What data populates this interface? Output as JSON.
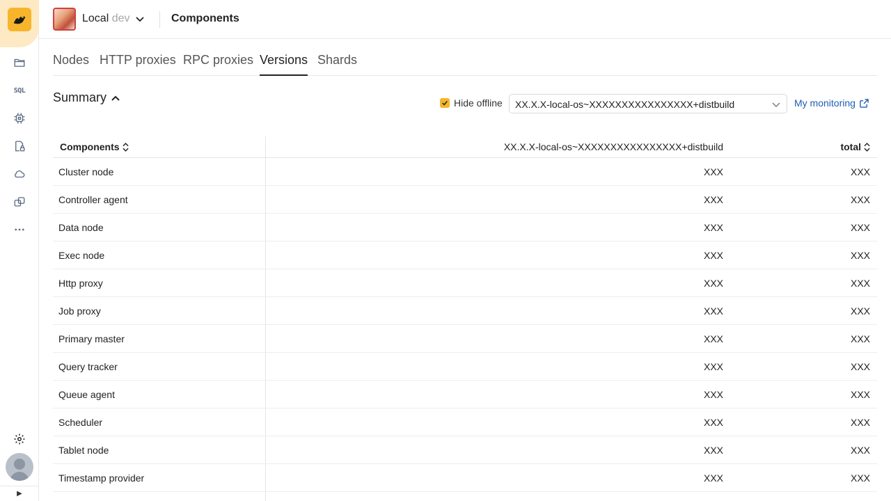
{
  "header": {
    "cluster_name": "Local",
    "cluster_env": "dev",
    "page_title": "Components"
  },
  "tabs": [
    {
      "label": "Nodes",
      "active": false
    },
    {
      "label": "HTTP proxies",
      "active": false
    },
    {
      "label": "RPC proxies",
      "active": false
    },
    {
      "label": "Versions",
      "active": true
    },
    {
      "label": "Shards",
      "active": false
    }
  ],
  "sidebar": {
    "sql_label": "SQL",
    "icons": [
      "folder-icon",
      "sql-icon",
      "chip-icon",
      "lock-doc-icon",
      "cloud-icon",
      "layers-icon",
      "more-icon"
    ]
  },
  "summary": {
    "title": "Summary",
    "hide_offline_label": "Hide offline",
    "hide_offline_checked": true,
    "version_selected": "XX.X.X-local-os~XXXXXXXXXXXXXXXX+distbuild",
    "monitoring_label": "My monitoring"
  },
  "table": {
    "headers": {
      "components": "Components",
      "version": "XX.X.X-local-os~XXXXXXXXXXXXXXXX+distbuild",
      "total": "total"
    },
    "rows": [
      {
        "name": "Cluster node",
        "version": "XXX",
        "total": "XXX"
      },
      {
        "name": "Controller agent",
        "version": "XXX",
        "total": "XXX"
      },
      {
        "name": "Data node",
        "version": "XXX",
        "total": "XXX"
      },
      {
        "name": "Exec node",
        "version": "XXX",
        "total": "XXX"
      },
      {
        "name": "Http proxy",
        "version": "XXX",
        "total": "XXX"
      },
      {
        "name": "Job proxy",
        "version": "XXX",
        "total": "XXX"
      },
      {
        "name": "Primary master",
        "version": "XXX",
        "total": "XXX"
      },
      {
        "name": "Query tracker",
        "version": "XXX",
        "total": "XXX"
      },
      {
        "name": "Queue agent",
        "version": "XXX",
        "total": "XXX"
      },
      {
        "name": "Scheduler",
        "version": "XXX",
        "total": "XXX"
      },
      {
        "name": "Tablet node",
        "version": "XXX",
        "total": "XXX"
      },
      {
        "name": "Timestamp provider",
        "version": "XXX",
        "total": "XXX"
      }
    ]
  },
  "colors": {
    "accent": "#f7b52b",
    "link": "#1e5fb3",
    "logo_bg": "#fde9c4"
  }
}
